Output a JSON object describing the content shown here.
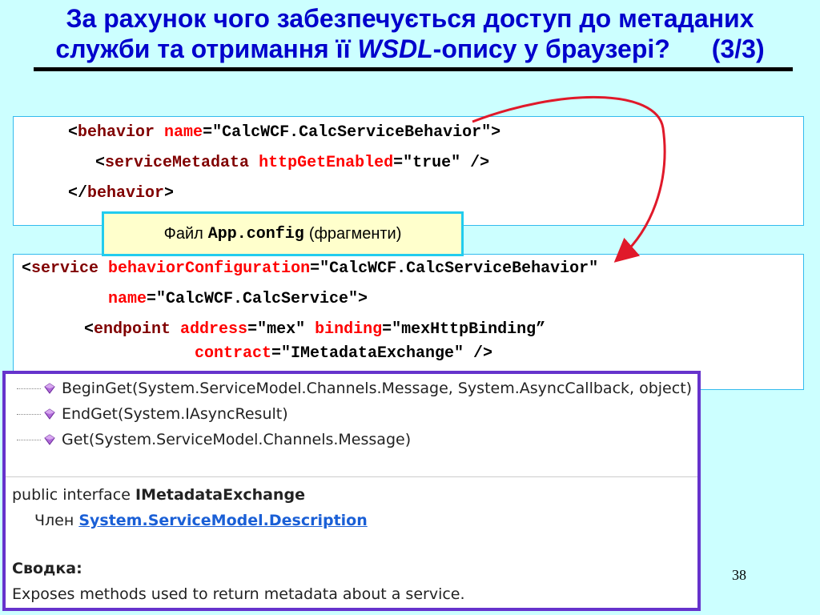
{
  "slide": {
    "title_line1": "За рахунок чого забезпечується доступ до метаданих",
    "title_line2_pre": "служби та отримання її ",
    "title_line2_italic": "WSDL",
    "title_line2_post": "-опису у браузері?",
    "title_counter": "(3/3)",
    "page_number": "38"
  },
  "box1": {
    "l1": {
      "lt": "<",
      "tag": "behavior",
      "attr": "name",
      "eq": "=\"CalcWCF.CalcServiceBehavior\">"
    },
    "l2": {
      "lt": "<",
      "tag": "serviceMetadata",
      "attr": "httpGetEnabled",
      "eq": "=\"true\" />"
    },
    "l3": {
      "lt": "</",
      "tag": "behavior",
      "gt": ">"
    }
  },
  "callout": {
    "pre": "Файл",
    "mono": "App.config",
    "post": "(фрагменти)"
  },
  "box2": {
    "l1": {
      "lt": "<",
      "tag": "service",
      "attr": "behaviorConfiguration",
      "eq": "=\"CalcWCF.CalcServiceBehavior\""
    },
    "l2": {
      "attr": "name",
      "eq": "=\"CalcWCF.CalcService\">"
    },
    "l3": {
      "lt": "<",
      "tag": "endpoint",
      "attr1": "address",
      "eq1": "=\"mex\"",
      "attr2": "binding",
      "eq2": "=\"mexHttpBinding”"
    },
    "l4": {
      "attr": "contract",
      "eq": "=\"IMetadataExchange\" />"
    }
  },
  "screenshot": {
    "methods": [
      "BeginGet(System.ServiceModel.Channels.Message, System.AsyncCallback, object)",
      "EndGet(System.IAsyncResult)",
      "Get(System.ServiceModel.Channels.Message)"
    ],
    "decl_prefix": "public interface ",
    "decl_name": "IMetadataExchange",
    "member_label": "Член ",
    "member_link": "System.ServiceModel.Description",
    "summary_label": "Сводка:",
    "summary_text": "Exposes methods used to return metadata about a service."
  },
  "colors": {
    "title": "#0000cc",
    "background": "#ccffff",
    "xml_tag": "#800000",
    "xml_attr": "#ff0000",
    "arrow": "#e0192a",
    "screenshot_border": "#6633cc",
    "callout_border": "#22ccee"
  },
  "icons": [
    "method-icon",
    "curved-arrow-icon"
  ]
}
